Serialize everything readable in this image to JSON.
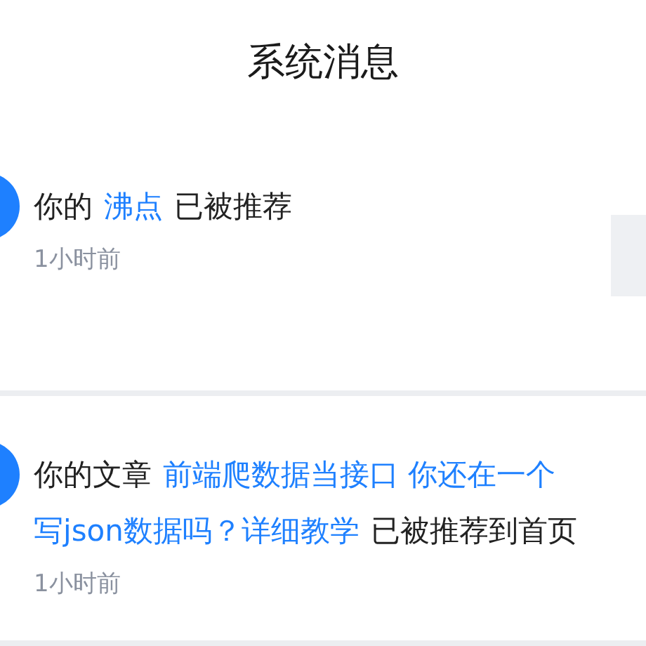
{
  "title": "系统消息",
  "notifications": [
    {
      "lines": [
        [
          {
            "kind": "text",
            "text": "你的"
          },
          {
            "kind": "link",
            "text": "沸点"
          },
          {
            "kind": "text",
            "text": "已被推荐"
          }
        ]
      ],
      "time": "1小时前",
      "thumbnail": true
    },
    {
      "lines": [
        [
          {
            "kind": "text",
            "text": "你的文章"
          },
          {
            "kind": "link",
            "text": "前端爬数据当接口 你还在一个"
          }
        ],
        [
          {
            "kind": "link",
            "text": "写json数据吗？详细教学"
          },
          {
            "kind": "text",
            "text": "已被推荐到首页"
          }
        ]
      ],
      "time": "1小时前",
      "thumbnail": false
    }
  ]
}
